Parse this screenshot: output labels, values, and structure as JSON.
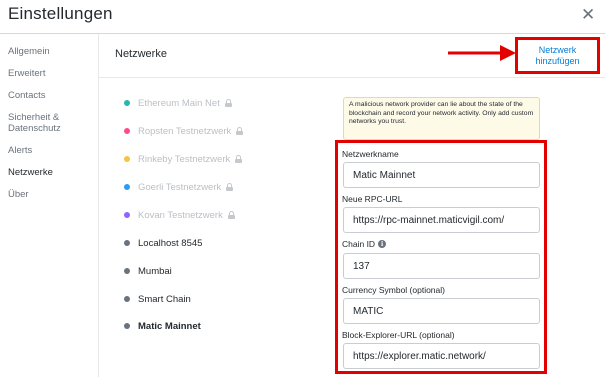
{
  "header": {
    "title": "Einstellungen",
    "close_icon": "close-icon"
  },
  "sidebar": {
    "items": [
      {
        "label": "Allgemein",
        "active": false
      },
      {
        "label": "Erweitert",
        "active": false
      },
      {
        "label": "Contacts",
        "active": false
      },
      {
        "label": "Sicherheit &\nDatenschutz",
        "active": false
      },
      {
        "label": "Alerts",
        "active": false
      },
      {
        "label": "Netzwerke",
        "active": true
      },
      {
        "label": "Über",
        "active": false
      }
    ]
  },
  "main": {
    "section_title": "Netzwerke",
    "add_network": {
      "line1": "Netzwerk",
      "line2": "hinzufügen"
    },
    "networks": [
      {
        "label": "Ethereum Main Net",
        "color": "#29b6af",
        "locked": true
      },
      {
        "label": "Ropsten Testnetzwerk",
        "color": "#ff4a8d",
        "locked": true
      },
      {
        "label": "Rinkeby Testnetzwerk",
        "color": "#f6c343",
        "locked": true
      },
      {
        "label": "Goerli Testnetzwerk",
        "color": "#3099f2",
        "locked": true
      },
      {
        "label": "Kovan Testnetzwerk",
        "color": "#9064ff",
        "locked": true
      },
      {
        "label": "Localhost 8545",
        "color": "#6a737d",
        "locked": false
      },
      {
        "label": "Mumbai",
        "color": "#6a737d",
        "locked": false
      },
      {
        "label": "Smart Chain",
        "color": "#6a737d",
        "locked": false
      },
      {
        "label": "Matic Mainnet",
        "color": "#6a737d",
        "locked": false,
        "selected": true
      }
    ],
    "warning": "A malicious network provider can lie about the state of the blockchain and record your network activity. Only add custom networks you trust.",
    "form": {
      "network_name_label": "Netzwerkname",
      "network_name_value": "Matic Mainnet",
      "rpc_label": "Neue RPC-URL",
      "rpc_value": "https://rpc-mainnet.maticvigil.com/",
      "chain_id_label": "Chain ID",
      "chain_id_value": "137",
      "symbol_label": "Currency Symbol (optional)",
      "symbol_value": "MATIC",
      "explorer_label": "Block-Explorer-URL (optional)",
      "explorer_value": "https://explorer.matic.network/"
    }
  },
  "colors": {
    "accent": "#037dd6",
    "highlight": "#e20000",
    "warning_bg": "#fefae8"
  }
}
